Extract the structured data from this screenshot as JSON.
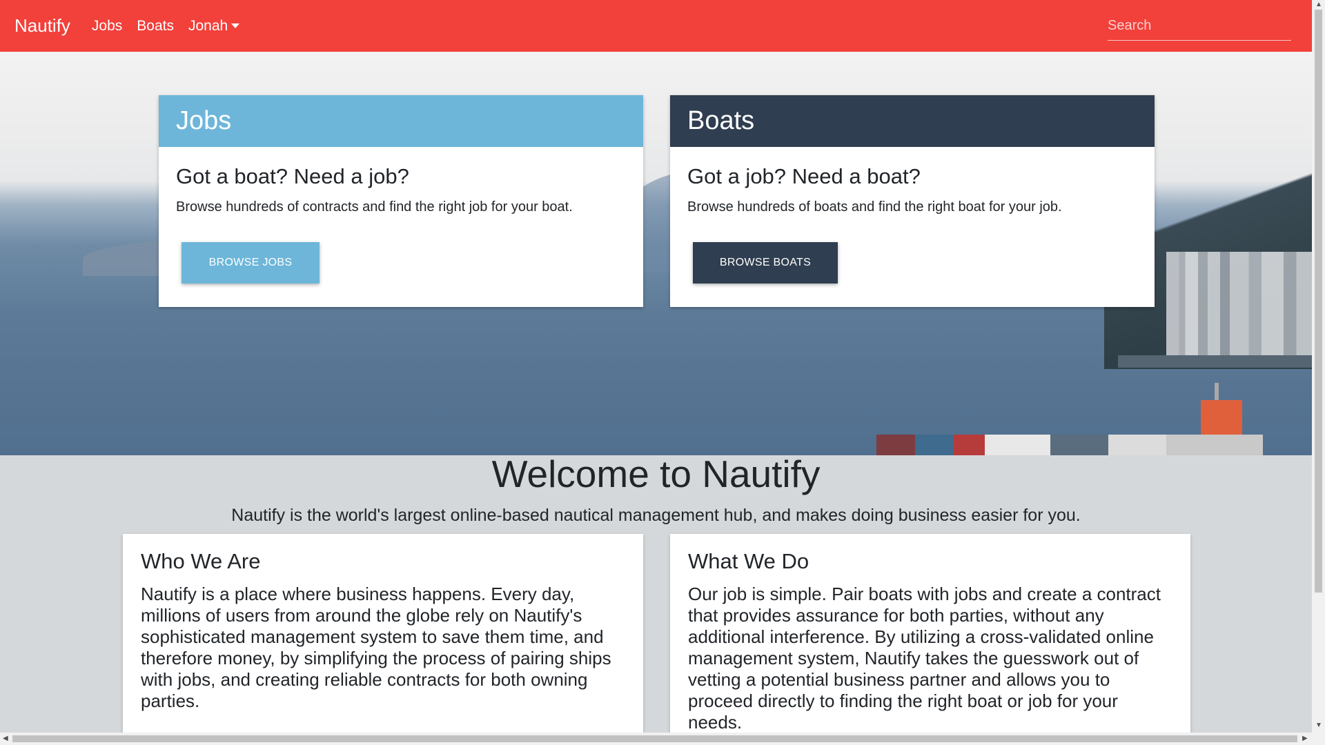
{
  "navbar": {
    "brand": "Nautify",
    "links": [
      "Jobs",
      "Boats"
    ],
    "user_menu": "Jonah",
    "search_placeholder": "Search",
    "color": "#f2403b"
  },
  "cards": {
    "jobs": {
      "header": "Jobs",
      "title": "Got a boat? Need a job?",
      "text": "Browse hundreds of contracts and find the right job for your boat.",
      "button": "Browse Jobs",
      "color": "#6db6d9"
    },
    "boats": {
      "header": "Boats",
      "title": "Got a job? Need a boat?",
      "text": "Browse hundreds of boats and find the right boat for your job.",
      "button": "Browse Boats",
      "color": "#2f3e50"
    }
  },
  "welcome": {
    "title": "Welcome to Nautify",
    "subtitle": "Nautify is the world's largest online-based nautical management hub, and makes doing business easier for you."
  },
  "info": {
    "who": {
      "title": "Who We Are",
      "text": "Nautify is a place where business happens. Every day, millions of users from around the globe rely on Nautify's sophisticated management system to save them time, and therefore money, by simplifying the process of pairing ships with jobs, and creating reliable contracts for both owning parties."
    },
    "what": {
      "title": "What We Do",
      "text": "Our job is simple. Pair boats with jobs and create a contract that provides assurance for both parties, without any additional interference. By utilizing a cross-validated online management system, Nautify takes the guesswork out of vetting a potential business partner and allows you to proceed directly to finding the right boat or job for your needs."
    }
  },
  "icons": {
    "caret": "caret-down-icon",
    "scroll_up": "▲",
    "scroll_down": "▼",
    "scroll_left": "◀",
    "scroll_right": "▶"
  }
}
